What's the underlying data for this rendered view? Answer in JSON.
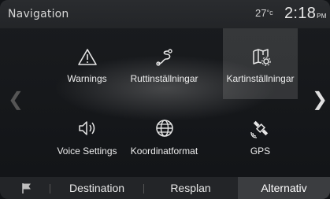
{
  "header": {
    "title": "Navigation",
    "temperature": "27",
    "temperature_unit": "°c",
    "time": "2:18",
    "time_suffix": "PM"
  },
  "tiles": [
    {
      "label": "Warnings",
      "icon": "warning-triangle-icon"
    },
    {
      "label": "Ruttinställningar",
      "icon": "route-icon"
    },
    {
      "label": "Kartinställningar",
      "icon": "map-settings-icon"
    },
    {
      "label": "Voice Settings",
      "icon": "speaker-icon"
    },
    {
      "label": "Koordinatformat",
      "icon": "globe-icon"
    },
    {
      "label": "GPS",
      "icon": "satellite-icon"
    }
  ],
  "selected_tile": "Kartinställningar",
  "tabs": [
    {
      "label": "Destination"
    },
    {
      "label": "Resplan"
    },
    {
      "label": "Alternativ"
    }
  ],
  "selected_tab": "Alternativ",
  "flag_icon": "flag-icon",
  "colors": {
    "background": "#15171a",
    "statusbar": "#2a2c2f",
    "tabbar": "#232528",
    "active_tab": "#3b3d40",
    "active_tile": "#5a5b5d"
  }
}
